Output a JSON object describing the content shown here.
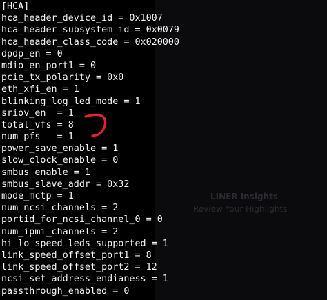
{
  "terminal": {
    "lines": [
      "[HCA]",
      "hca_header_device_id = 0x1007",
      "hca_header_subsystem_id = 0x0079",
      "hca_header_class_code = 0x020000",
      "dpdp_en = 0",
      "mdio_en_port1 = 0",
      "pcie_tx_polarity = 0x0",
      "eth_xfi_en = 1",
      "blinking_log_led_mode = 1",
      "sriov_en  = 1",
      "total_vfs = 8",
      "num_pfs   = 1",
      "power_save_enable = 1",
      "slow_clock_enable = 0",
      "smbus_enable = 1",
      "smbus_slave_addr = 0x32",
      "mode_mctp = 1",
      "num_ncsi_channels = 2",
      "portid_for_ncsi_channel_0 = 0",
      "num_ipmi_channels = 2",
      "hi_lo_speed_leds_supported = 1",
      "link_speed_offset_port1 = 8",
      "link_speed_offset_port2 = 12",
      "ncsi_set_address_endianess = 1",
      "passthrough_enabled = 0"
    ]
  },
  "background": {
    "faded_text": [
      "LINER Insights",
      "Review Your Highlights"
    ]
  },
  "colors": {
    "background": "#000000",
    "text": "#f2f2f2",
    "annotation": "#e8202a"
  },
  "icons": {
    "annotation": "red-bracket-icon"
  }
}
